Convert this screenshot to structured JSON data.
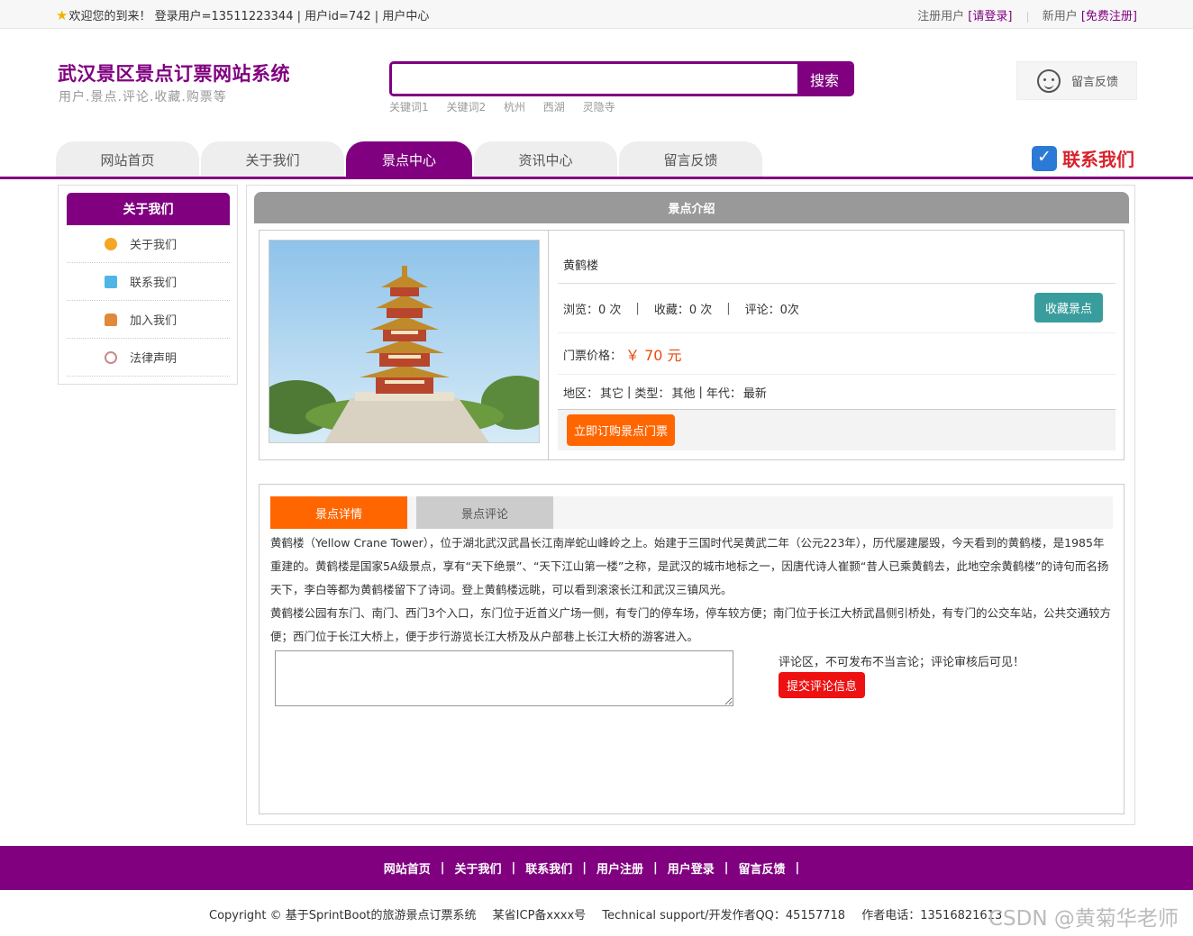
{
  "topbar": {
    "welcome": "欢迎您的到来！ 登录用户=13511223344 | 用户id=742 | 用户中心",
    "reg_prefix": "注册用户",
    "login_link": "[请登录]",
    "new_prefix": "新用户",
    "register_link": "[免费注册]"
  },
  "header": {
    "title": "武汉景区景点订票网站系统",
    "subtitle": "用户.景点.评论.收藏.购票等",
    "search_placeholder": "",
    "search_button": "搜索",
    "keywords": [
      "关键词1",
      "关键词2",
      "杭州",
      "西湖",
      "灵隐寺"
    ],
    "feedback": "留言反馈"
  },
  "nav": {
    "items": [
      "网站首页",
      "关于我们",
      "景点中心",
      "资讯中心",
      "留言反馈"
    ],
    "active_index": 2,
    "contact": "联系我们"
  },
  "sidebar": {
    "title": "关于我们",
    "items": [
      {
        "label": "关于我们",
        "icon": "coin-icon",
        "color": "#f5a623"
      },
      {
        "label": "联系我们",
        "icon": "clipboard-icon",
        "color": "#4db6e6"
      },
      {
        "label": "加入我们",
        "icon": "lock-icon",
        "color": "#e0893b"
      },
      {
        "label": "法律声明",
        "icon": "power-icon",
        "color": "#c88a8a"
      }
    ]
  },
  "detail": {
    "section_title": "景点介绍",
    "name": "黄鹤楼",
    "views_label": "浏览：",
    "views": "0 次",
    "favs_label": "收藏：",
    "favs": "0 次",
    "comments_label": "评论：",
    "comments": "0次",
    "fav_button": "收藏景点",
    "price_label": "门票价格：",
    "price": "￥ 70 元",
    "region_label": "地区：",
    "region": "其它",
    "type_label": "类型：",
    "type": "其他",
    "era_label": "年代：",
    "era": "最新",
    "buy_button": "立即订购景点门票"
  },
  "tabs": [
    "景点详情",
    "景点评论"
  ],
  "description": [
    "黄鹤楼（Yellow Crane Tower），位于湖北武汉武昌长江南岸蛇山峰岭之上。始建于三国时代吴黄武二年（公元223年），历代屡建屡毁，今天看到的黄鹤楼，是1985年重建的。黄鹤楼是国家5A级景点，享有“天下绝景”、“天下江山第一楼”之称，是武汉的城市地标之一，因唐代诗人崔颢“昔人已乘黄鹤去，此地空余黄鹤楼”的诗句而名扬天下，李白等都为黄鹤楼留下了诗词。登上黄鹤楼远眺，可以看到滚滚长江和武汉三镇风光。",
    "黄鹤楼公园有东门、南门、西门3个入口，东门位于近首义广场一侧，有专门的停车场，停车较方便；南门位于长江大桥武昌侧引桥处，有专门的公交车站，公共交通较方便；西门位于长江大桥上，便于步行游览长江大桥及从户部巷上长江大桥的游客进入。"
  ],
  "comment": {
    "note": "评论区，不可发布不当言论；评论审核后可见！",
    "submit": "提交评论信息"
  },
  "footer": {
    "links": [
      "网站首页",
      "关于我们",
      "联系我们",
      "用户注册",
      "用户登录",
      "留言反馈"
    ],
    "copyright": "Copyright © 基于SprintBoot的旅游景点订票系统",
    "icp": "某省ICP备xxxx号",
    "support": "Technical support/开发作者QQ：45157718",
    "phone": "作者电话：13516821613"
  },
  "watermark": "CSDN @黄菊华老师",
  "colors": {
    "brand": "#800080",
    "accent": "#ff6600",
    "teal": "#3a9d9d",
    "red": "#ee1111"
  }
}
